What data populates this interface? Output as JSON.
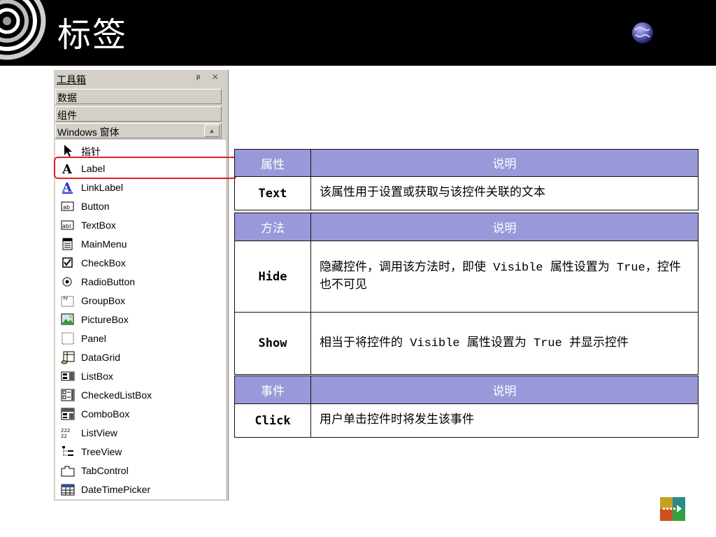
{
  "slide": {
    "title": "标签"
  },
  "toolbox": {
    "title": "工具箱",
    "pin": "ᵖ",
    "close": "×",
    "tabs": [
      "数据",
      "组件",
      "Windows 窗体"
    ],
    "items": [
      {
        "label": "指针",
        "icon": "pointer-icon"
      },
      {
        "label": "Label",
        "icon": "label-icon"
      },
      {
        "label": "LinkLabel",
        "icon": "linklabel-icon"
      },
      {
        "label": "Button",
        "icon": "button-icon"
      },
      {
        "label": "TextBox",
        "icon": "textbox-icon"
      },
      {
        "label": "MainMenu",
        "icon": "mainmenu-icon"
      },
      {
        "label": "CheckBox",
        "icon": "checkbox-icon"
      },
      {
        "label": "RadioButton",
        "icon": "radiobutton-icon"
      },
      {
        "label": "GroupBox",
        "icon": "groupbox-icon"
      },
      {
        "label": "PictureBox",
        "icon": "picturebox-icon"
      },
      {
        "label": "Panel",
        "icon": "panel-icon"
      },
      {
        "label": "DataGrid",
        "icon": "datagrid-icon"
      },
      {
        "label": "ListBox",
        "icon": "listbox-icon"
      },
      {
        "label": "CheckedListBox",
        "icon": "checkedlistbox-icon"
      },
      {
        "label": "ComboBox",
        "icon": "combobox-icon"
      },
      {
        "label": "ListView",
        "icon": "listview-icon"
      },
      {
        "label": "TreeView",
        "icon": "treeview-icon"
      },
      {
        "label": "TabControl",
        "icon": "tabcontrol-icon"
      },
      {
        "label": "DateTimePicker",
        "icon": "datetimepicker-icon"
      }
    ]
  },
  "properties": {
    "header": [
      "属性",
      "说明"
    ],
    "rows": [
      {
        "name": "Text",
        "desc": "该属性用于设置或获取与该控件关联的文本"
      }
    ]
  },
  "methods": {
    "header": [
      "方法",
      "说明"
    ],
    "rows": [
      {
        "name": "Hide",
        "desc": "隐藏控件，调用该方法时，即使 Visible 属性设置为 True，控件也不可见"
      },
      {
        "name": "Show",
        "desc": "相当于将控件的 Visible 属性设置为 True 并显示控件"
      }
    ]
  },
  "events": {
    "header": [
      "事件",
      "说明"
    ],
    "rows": [
      {
        "name": "Click",
        "desc": "用户单击控件时将发生该事件"
      }
    ]
  },
  "colors": {
    "banner": "#000000",
    "table_header": "#9999d9",
    "highlight": "#e02020",
    "toolbox_bg": "#d4d0c8"
  }
}
